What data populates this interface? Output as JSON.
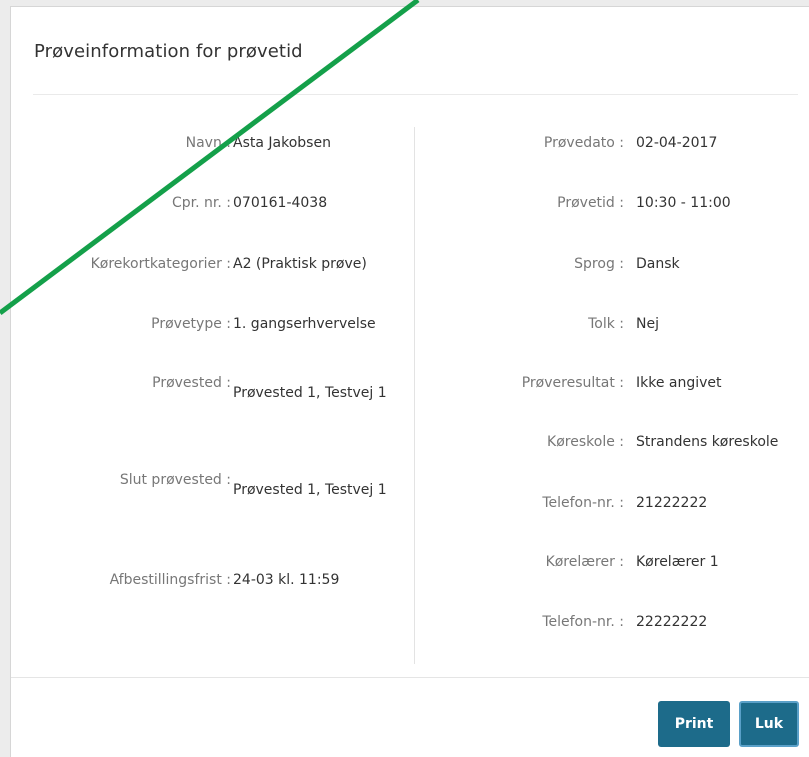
{
  "dialog": {
    "title": "Prøveinformation for prøvetid"
  },
  "left_fields": [
    {
      "label": "Navn :",
      "value": "Asta Jakobsen"
    },
    {
      "label": "Cpr. nr. :",
      "value": "070161-4038"
    },
    {
      "label": "Kørekortkategorier :",
      "value": "A2 (Praktisk prøve)"
    },
    {
      "label": "Prøvetype :",
      "value": "1. gangserhvervelse"
    },
    {
      "label": "Prøvested :",
      "value": "Prøvested 1, Testvej 1"
    },
    {
      "label": "Slut prøvested :",
      "value": "Prøvested 1, Testvej 1"
    },
    {
      "label": "Afbestillingsfrist :",
      "value": "24-03 kl. 11:59"
    }
  ],
  "right_fields": [
    {
      "label": "Prøvedato :",
      "value": "02-04-2017"
    },
    {
      "label": "Prøvetid :",
      "value": "10:30 - 11:00"
    },
    {
      "label": "Sprog :",
      "value": "Dansk"
    },
    {
      "label": "Tolk :",
      "value": "Nej"
    },
    {
      "label": "Prøveresultat :",
      "value": "Ikke angivet"
    },
    {
      "label": "Køreskole :",
      "value": "Strandens køreskole"
    },
    {
      "label": "Telefon-nr. :",
      "value": "21222222"
    },
    {
      "label": "Kørelærer :",
      "value": "Kørelærer 1"
    },
    {
      "label": "Telefon-nr. :",
      "value": "22222222"
    }
  ],
  "footer": {
    "print_label": "Print",
    "close_label": "Luk"
  },
  "colors": {
    "button": "#1d6b8a",
    "annotation_line": "#14a04a"
  }
}
